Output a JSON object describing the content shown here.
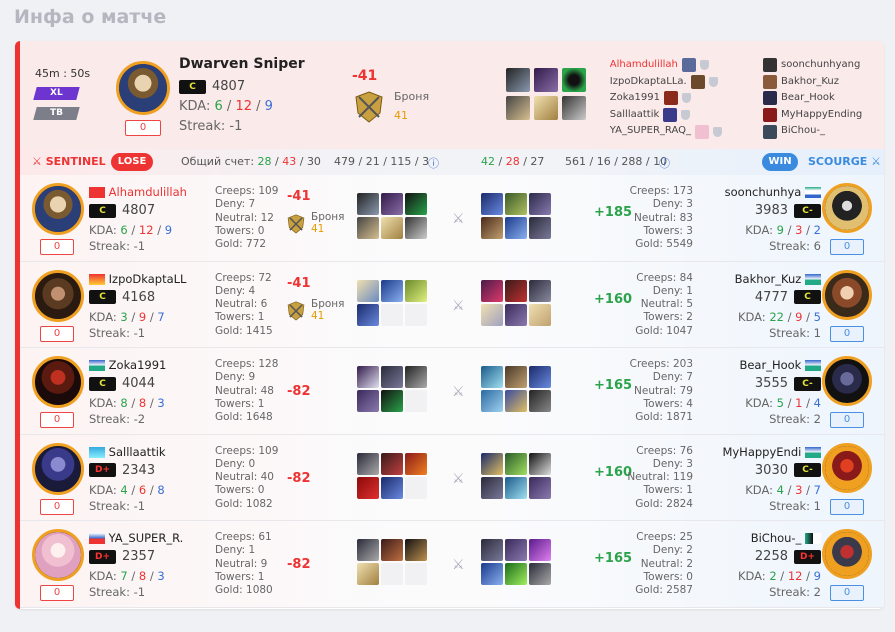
{
  "page_title": "Инфа о матче",
  "summary": {
    "time": "45m : 50s",
    "tag_xl": "XL",
    "tag_tb": "TB",
    "badge": "0",
    "hero": "Dwarven Sniper",
    "rank": "C",
    "mmr": "4807",
    "kda_label": "KDA:",
    "k": "6",
    "d": "12",
    "a": "9",
    "streak": "Streak: -1",
    "delta": "-41",
    "armor_label": "Броня",
    "armor_val": "41",
    "left_players": [
      "Alhamdulillah",
      "IzpoDkaptaLLa.",
      "Zoka1991",
      "Salllaattik",
      "YA_SUPER_RAQ_"
    ],
    "right_players": [
      "soonchunhyang",
      "Bakhor_Kuz",
      "Bear_Hook",
      "MyHappyEnding",
      "BiChou-_"
    ]
  },
  "bar": {
    "sentinel": "SENTINEL",
    "lose": "LOSE",
    "score_label": "Общий счет:",
    "l_k": "28",
    "l_d": "43",
    "l_a": "30",
    "l_rest": "479 / 21 / 115 / 3",
    "r_k": "42",
    "r_d": "28",
    "r_a": "27",
    "r_rest": "561 / 16 / 288 / 10",
    "win": "WIN",
    "scourge": "SCOURGE"
  },
  "rows": [
    {
      "l": {
        "name": "Alhamdulillah",
        "rank": "C",
        "mmr": "4807",
        "k": "6",
        "d": "12",
        "a": "9",
        "streak": "Streak: -1",
        "badge": "0",
        "creeps": "Creeps: 109",
        "deny": "Deny: 7",
        "neutral": "Neutral: 12",
        "towers": "Towers: 0",
        "gold": "Gold: 772",
        "delta": "-41",
        "armor": "Броня",
        "armor_val": "41"
      },
      "r": {
        "name": "soonchunhya",
        "rank": "C-",
        "mmr": "3983",
        "k": "9",
        "d": "3",
        "a": "2",
        "streak": "Streak: 6",
        "badge": "0",
        "creeps": "Creeps: 173",
        "deny": "Deny: 3",
        "neutral": "Neutral: 83",
        "towers": "Towers: 3",
        "gold": "Gold: 5549",
        "delta": "+185"
      }
    },
    {
      "l": {
        "name": "IzpoDkaptaLL",
        "rank": "C",
        "mmr": "4168",
        "k": "3",
        "d": "9",
        "a": "7",
        "streak": "Streak: -1",
        "badge": "0",
        "creeps": "Creeps: 72",
        "deny": "Deny: 4",
        "neutral": "Neutral: 6",
        "towers": "Towers: 1",
        "gold": "Gold: 1415",
        "delta": "-41",
        "armor": "Броня",
        "armor_val": "41"
      },
      "r": {
        "name": "Bakhor_Kuz",
        "rank": "C",
        "mmr": "4777",
        "k": "22",
        "d": "9",
        "a": "5",
        "streak": "Streak: 1",
        "badge": "0",
        "creeps": "Creeps: 84",
        "deny": "Deny: 1",
        "neutral": "Neutral: 5",
        "towers": "Towers: 2",
        "gold": "Gold: 1047",
        "delta": "+160"
      }
    },
    {
      "l": {
        "name": "Zoka1991",
        "rank": "C",
        "mmr": "4044",
        "k": "8",
        "d": "8",
        "a": "3",
        "streak": "Streak: -2",
        "badge": "0",
        "creeps": "Creeps: 128",
        "deny": "Deny: 9",
        "neutral": "Neutral: 48",
        "towers": "Towers: 1",
        "gold": "Gold: 1648",
        "delta": "-82"
      },
      "r": {
        "name": "Bear_Hook",
        "rank": "C-",
        "mmr": "3555",
        "k": "5",
        "d": "1",
        "a": "4",
        "streak": "Streak: 2",
        "badge": "0",
        "creeps": "Creeps: 203",
        "deny": "Deny: 7",
        "neutral": "Neutral: 79",
        "towers": "Towers: 4",
        "gold": "Gold: 1871",
        "delta": "+165"
      }
    },
    {
      "l": {
        "name": "Salllaattik",
        "rank": "D+",
        "mmr": "2343",
        "k": "4",
        "d": "6",
        "a": "8",
        "streak": "Streak: -1",
        "badge": "0",
        "creeps": "Creeps: 109",
        "deny": "Deny: 0",
        "neutral": "Neutral: 40",
        "towers": "Towers: 0",
        "gold": "Gold: 1082",
        "delta": "-82"
      },
      "r": {
        "name": "MyHappyEndi",
        "rank": "C-",
        "mmr": "3030",
        "k": "4",
        "d": "3",
        "a": "7",
        "streak": "Streak: 1",
        "badge": "0",
        "creeps": "Creeps: 76",
        "deny": "Deny: 3",
        "neutral": "Neutral: 119",
        "towers": "Towers: 1",
        "gold": "Gold: 2824",
        "delta": "+160"
      }
    },
    {
      "l": {
        "name": "YA_SUPER_R.",
        "rank": "D+",
        "mmr": "2357",
        "k": "7",
        "d": "8",
        "a": "3",
        "streak": "Streak: -1",
        "badge": "0",
        "creeps": "Creeps: 61",
        "deny": "Deny: 1",
        "neutral": "Neutral: 9",
        "towers": "Towers: 1",
        "gold": "Gold: 1080",
        "delta": "-82"
      },
      "r": {
        "name": "BiChou-_",
        "rank": "D+",
        "mmr": "2258",
        "k": "2",
        "d": "12",
        "a": "9",
        "streak": "Streak: 2",
        "badge": "0",
        "creeps": "Creeps: 25",
        "deny": "Deny: 2",
        "neutral": "Neutral: 2",
        "towers": "Towers: 0",
        "gold": "Gold: 2587",
        "delta": "+165"
      }
    }
  ]
}
